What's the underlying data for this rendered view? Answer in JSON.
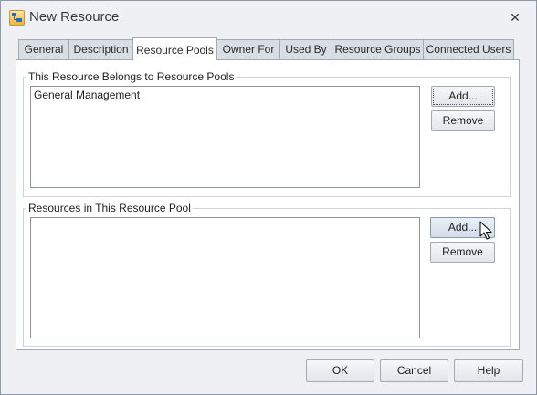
{
  "window": {
    "title": "New Resource",
    "close_glyph": "✕"
  },
  "tabs": [
    {
      "label": "General"
    },
    {
      "label": "Description"
    },
    {
      "label": "Resource Pools",
      "active": true
    },
    {
      "label": "Owner For"
    },
    {
      "label": "Used By"
    },
    {
      "label": "Resource Groups"
    },
    {
      "label": "Connected Users"
    }
  ],
  "belongs_section": {
    "title": "This Resource Belongs to Resource Pools",
    "items": [
      "General Management"
    ],
    "add_label": "Add...",
    "remove_label": "Remove"
  },
  "pool_section": {
    "title": "Resources in This Resource Pool",
    "items": [],
    "add_label": "Add...",
    "remove_label": "Remove"
  },
  "footer": {
    "ok_label": "OK",
    "cancel_label": "Cancel",
    "help_label": "Help"
  },
  "icons": {
    "app": "resource-icon",
    "close": "close-icon",
    "cursor": "mouse-pointer"
  }
}
